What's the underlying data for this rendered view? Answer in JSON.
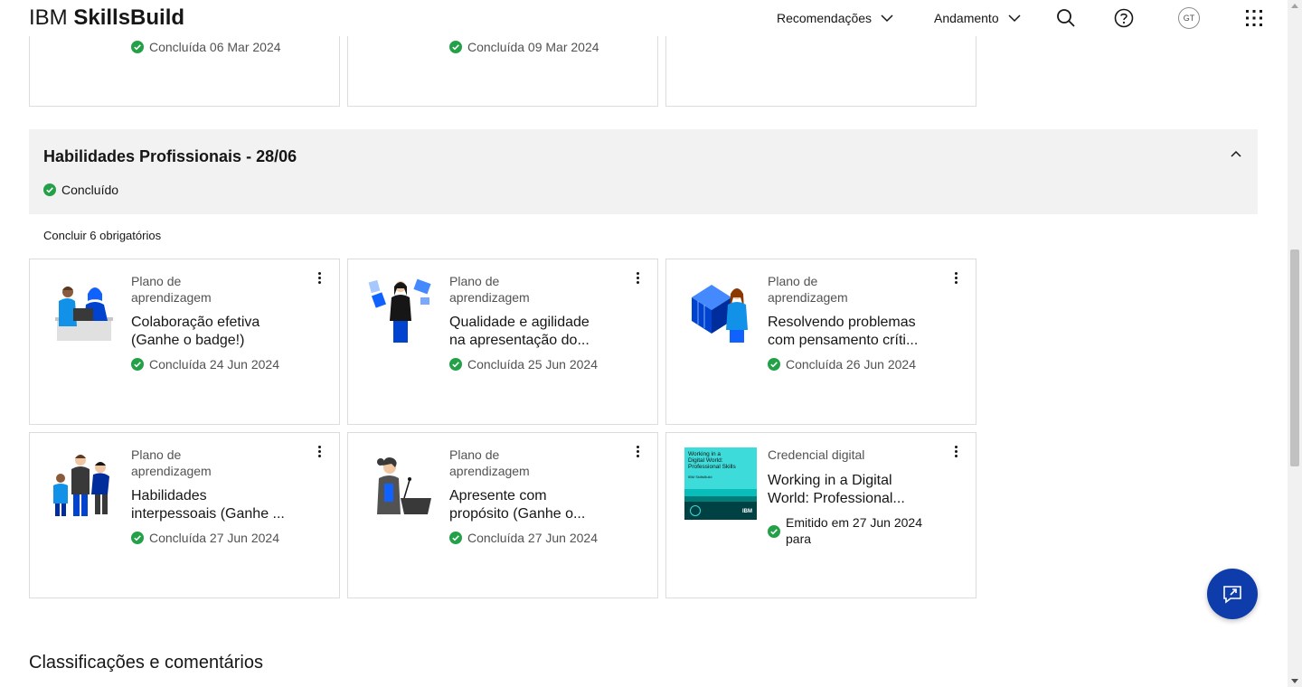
{
  "header": {
    "brand_ibm": "IBM",
    "brand_product": "SkillsBuild",
    "nav": [
      {
        "label": "Recomendações"
      },
      {
        "label": "Andamento"
      }
    ],
    "avatar_initials": "GT"
  },
  "top_cards": [
    {
      "status": "Concluída 06 Mar 2024"
    },
    {
      "status": "Concluída 09 Mar 2024"
    },
    {
      "status": ""
    }
  ],
  "section": {
    "title": "Habilidades Profissionais - 28/06",
    "status": "Concluído",
    "required_label": "Concluir 6 obrigatórios"
  },
  "cards": [
    {
      "type_line1": "Plano de",
      "type_line2": "aprendizagem",
      "title_line1": "Colaboração efetiva",
      "title_line2": "(Ganhe o badge!)",
      "status": "Concluída 24 Jun 2024",
      "image": "two-people-laptop-illustration"
    },
    {
      "type_line1": "Plano de",
      "type_line2": "aprendizagem",
      "title_line1": "Qualidade e agilidade",
      "title_line2": "na apresentação do...",
      "status": "Concluída 25 Jun 2024",
      "image": "woman-with-documents-illustration"
    },
    {
      "type_line1": "Plano de",
      "type_line2": "aprendizagem",
      "title_line1": "Resolvendo problemas",
      "title_line2": "com pensamento críti...",
      "status": "Concluída 26 Jun 2024",
      "image": "woman-with-cube-illustration"
    },
    {
      "type_line1": "Plano de",
      "type_line2": "aprendizagem",
      "title_line1": "Habilidades",
      "title_line2": "interpessoais (Ganhe ...",
      "status": "Concluída 27 Jun 2024",
      "image": "group-of-people-illustration"
    },
    {
      "type_line1": "Plano de",
      "type_line2": "aprendizagem",
      "title_line1": "Apresente com",
      "title_line2": "propósito (Ganhe o...",
      "status": "Concluída 27 Jun 2024",
      "image": "woman-at-podium-illustration"
    },
    {
      "type_line1": "Credencial digital",
      "type_line2": "",
      "title_line1": "Working in a Digital",
      "title_line2": "World: Professional...",
      "status_line1": "Emitido em 27 Jun 2024",
      "status_line2": "para",
      "image": "credential-cover"
    }
  ],
  "credential_cover": {
    "line1": "Working in a",
    "line2": "Digital World:",
    "line3": "Professional Skills",
    "sub": "IBM SkillsBuild",
    "logo": "IBM"
  },
  "bottom_heading": "Classificações e comentários",
  "colors": {
    "success": "#24a148",
    "fab": "#0f3cab",
    "section_bg": "#f2f2f2",
    "border": "#dcdcdc",
    "credential_teal": "#3ddbd9"
  }
}
